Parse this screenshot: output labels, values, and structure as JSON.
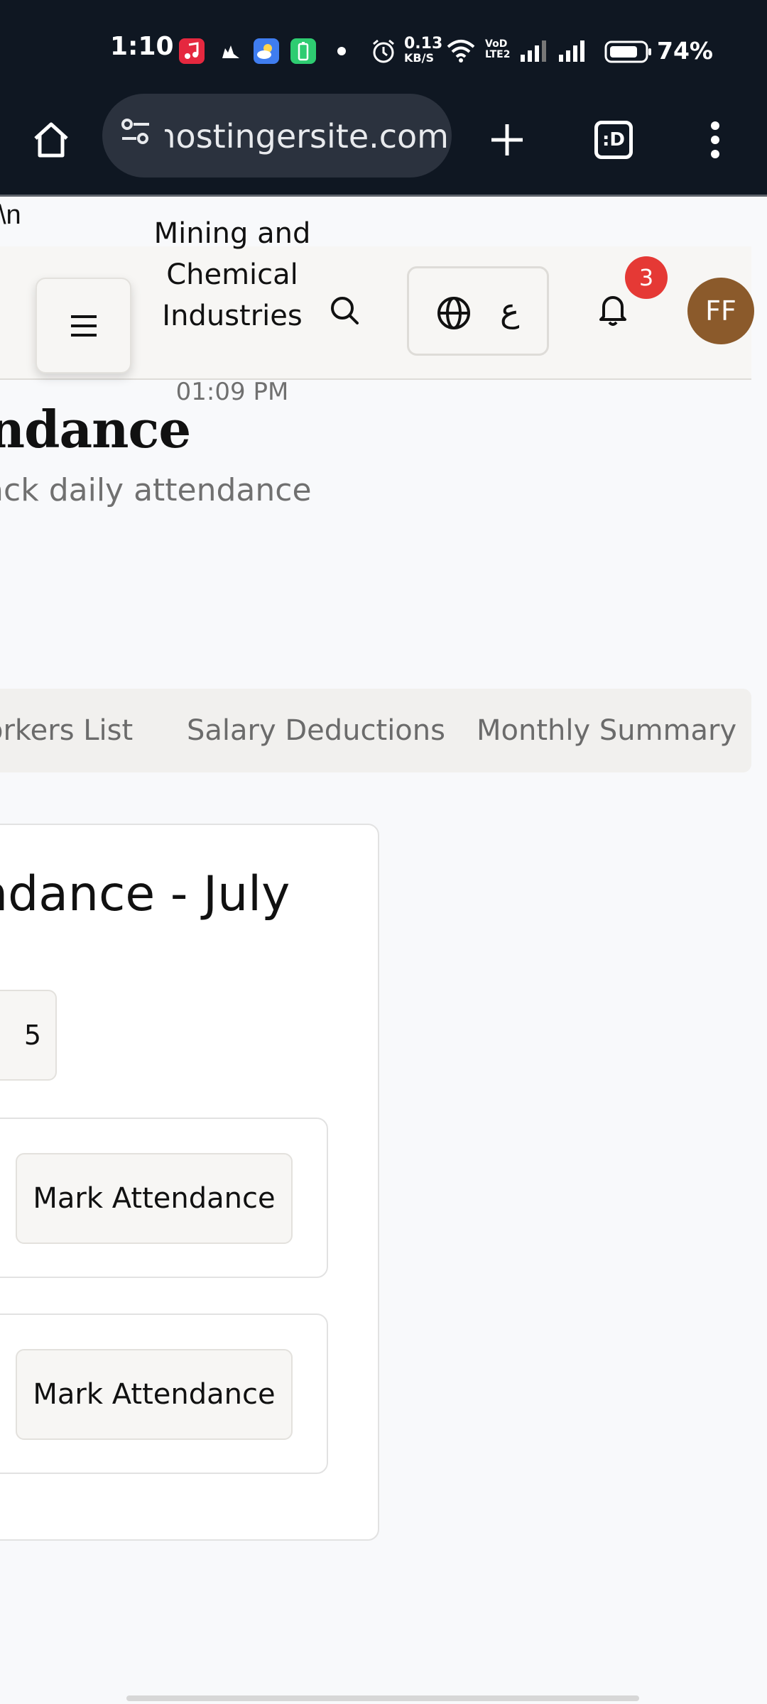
{
  "status_bar": {
    "time": "1:10",
    "network_speed_top": "0.13",
    "network_speed_unit": "KB/S",
    "volte_label": "VoD LTE2",
    "battery_percent": "74%"
  },
  "browser": {
    "url": "hostingersite.com",
    "tab_switcher_label": ":D"
  },
  "page": {
    "stray_text": "\\n",
    "header": {
      "org_name": "Mining and Chemical Industries",
      "time": "01:09 PM",
      "language_label": "ع",
      "notification_count": "3",
      "avatar_initials": "FF"
    },
    "title": "endance",
    "subtitle": "rack daily attendance",
    "tabs": [
      {
        "label": "orkers List"
      },
      {
        "label": "Salary Deductions"
      },
      {
        "label": "Monthly Summary"
      }
    ],
    "attendance_card": {
      "title": "ndance - July",
      "date_value": "5",
      "rows": [
        {
          "button_label": "Mark Attendance"
        },
        {
          "button_label": "Mark Attendance"
        }
      ]
    }
  },
  "colors": {
    "status_bar_bg": "#0f1722",
    "url_pill_bg": "#2b323e",
    "badge": "#e53935",
    "avatar_bg": "#8b5a2b",
    "header_bg": "#f7f6f4"
  },
  "icons": [
    "home-icon",
    "site-settings-icon",
    "new-tab-icon",
    "tab-switcher-icon",
    "more-menu-icon",
    "hamburger-menu-icon",
    "search-icon",
    "globe-icon",
    "bell-icon",
    "wifi-icon",
    "signal-icon",
    "battery-icon",
    "alarm-icon"
  ]
}
